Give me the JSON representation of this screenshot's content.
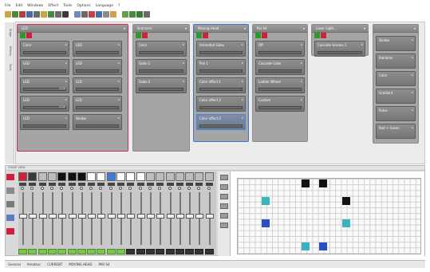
{
  "menu": [
    "File",
    "Edit",
    "Windows",
    "Effect",
    "Tools",
    "Options",
    "Language",
    "?"
  ],
  "left_tabs": [
    "Stage",
    "Effects",
    "Tools"
  ],
  "groups": [
    {
      "name": "LED",
      "color": "pink",
      "items": [
        {
          "label": "Color",
          "value": ""
        },
        {
          "label": "LED",
          "value": ""
        },
        {
          "label": "LED",
          "value": ""
        },
        {
          "label": "LED",
          "value": ""
        },
        {
          "label": "LED",
          "value": "0.00"
        },
        {
          "label": "LED",
          "value": ""
        },
        {
          "label": "LED",
          "value": "0.00"
        },
        {
          "label": "LED",
          "value": ""
        },
        {
          "label": "LED",
          "value": ""
        },
        {
          "label": "Strobe",
          "value": ""
        }
      ]
    },
    {
      "name": "Scanners",
      "color": "gray",
      "items": [
        {
          "label": "Color",
          "value": ""
        },
        {
          "label": "Gobo 1",
          "value": ""
        },
        {
          "label": "Gobo 2",
          "value": ""
        }
      ]
    },
    {
      "name": "Moving Head",
      "color": "blue",
      "items": [
        {
          "label": "Animated Gobo",
          "value": ""
        },
        {
          "label": "Pan 1",
          "value": ""
        },
        {
          "label": "Color effect 1",
          "value": ""
        },
        {
          "label": "Color effect 2",
          "value": ""
        },
        {
          "label": "Color effect 3",
          "value": ""
        }
      ]
    },
    {
      "name": "Par 64",
      "color": "gray",
      "items": [
        {
          "label": "Off",
          "value": ""
        },
        {
          "label": "Cascade Color",
          "value": ""
        },
        {
          "label": "Ladder Wheel",
          "value": ""
        },
        {
          "label": "Custom",
          "value": ""
        }
      ]
    },
    {
      "name": "Laser Light...",
      "color": "gray",
      "items": [
        {
          "label": "Cascade Scenes 1",
          "value": ""
        }
      ]
    }
  ],
  "right_panel": {
    "items": [
      "Strobe",
      "Rainbow",
      "Color",
      "Gradient",
      "Pulse",
      "Red + Green"
    ]
  },
  "dock": {
    "title": "STAGE VIEW"
  },
  "fader_strips": [
    {
      "color": "#d0203a",
      "level": 0.55,
      "flash": "green"
    },
    {
      "color": "#3a3a3a",
      "level": 0.55,
      "flash": "green"
    },
    {
      "color": "#bdbdbd",
      "level": 0.55,
      "flash": "green"
    },
    {
      "color": "#bdbdbd",
      "level": 0.55,
      "flash": "green"
    },
    {
      "color": "#111111",
      "level": 0.55,
      "flash": "green"
    },
    {
      "color": "#111111",
      "level": 0.55,
      "flash": "green"
    },
    {
      "color": "#111111",
      "level": 0.55,
      "flash": "green"
    },
    {
      "color": "#ffffff",
      "level": 0.55,
      "flash": "green"
    },
    {
      "color": "#ffffff",
      "level": 0.55,
      "flash": "green"
    },
    {
      "color": "#3c7cd6",
      "level": 0.55,
      "flash": "green"
    },
    {
      "color": "#ffffff",
      "level": 0.55,
      "flash": "green"
    },
    {
      "color": "#ffffff",
      "level": 0.55,
      "flash": "dark"
    },
    {
      "color": "#ffffff",
      "level": 0.55,
      "flash": "dark"
    },
    {
      "color": "#bdbdbd",
      "level": 0.55,
      "flash": "dark"
    },
    {
      "color": "#bdbdbd",
      "level": 0.55,
      "flash": "dark"
    },
    {
      "color": "#bdbdbd",
      "level": 0.55,
      "flash": "dark"
    },
    {
      "color": "#bdbdbd",
      "level": 0.55,
      "flash": "dark"
    },
    {
      "color": "#bdbdbd",
      "level": 0.55,
      "flash": "dark"
    },
    {
      "color": "#bdbdbd",
      "level": 0.55,
      "flash": "dark"
    },
    {
      "color": "#bdbdbd",
      "level": 0.55,
      "flash": "dark"
    }
  ],
  "grid": {
    "cells": [
      {
        "col": 11,
        "row": 0,
        "color": "#111111"
      },
      {
        "col": 14,
        "row": 0,
        "color": "#111111"
      },
      {
        "col": 4,
        "row": 3,
        "color": "#3ab3c0"
      },
      {
        "col": 18,
        "row": 3,
        "color": "#111111"
      },
      {
        "col": 4,
        "row": 7,
        "color": "#2a4fc4"
      },
      {
        "col": 18,
        "row": 7,
        "color": "#3ab3c0"
      },
      {
        "col": 11,
        "row": 11,
        "color": "#3ab3c0"
      },
      {
        "col": 14,
        "row": 11,
        "color": "#2a4fc4"
      }
    ]
  },
  "status": {
    "items": [
      "General",
      "Amateur",
      "CURRENT",
      "MOVING HEAD",
      "PAR 64"
    ]
  }
}
